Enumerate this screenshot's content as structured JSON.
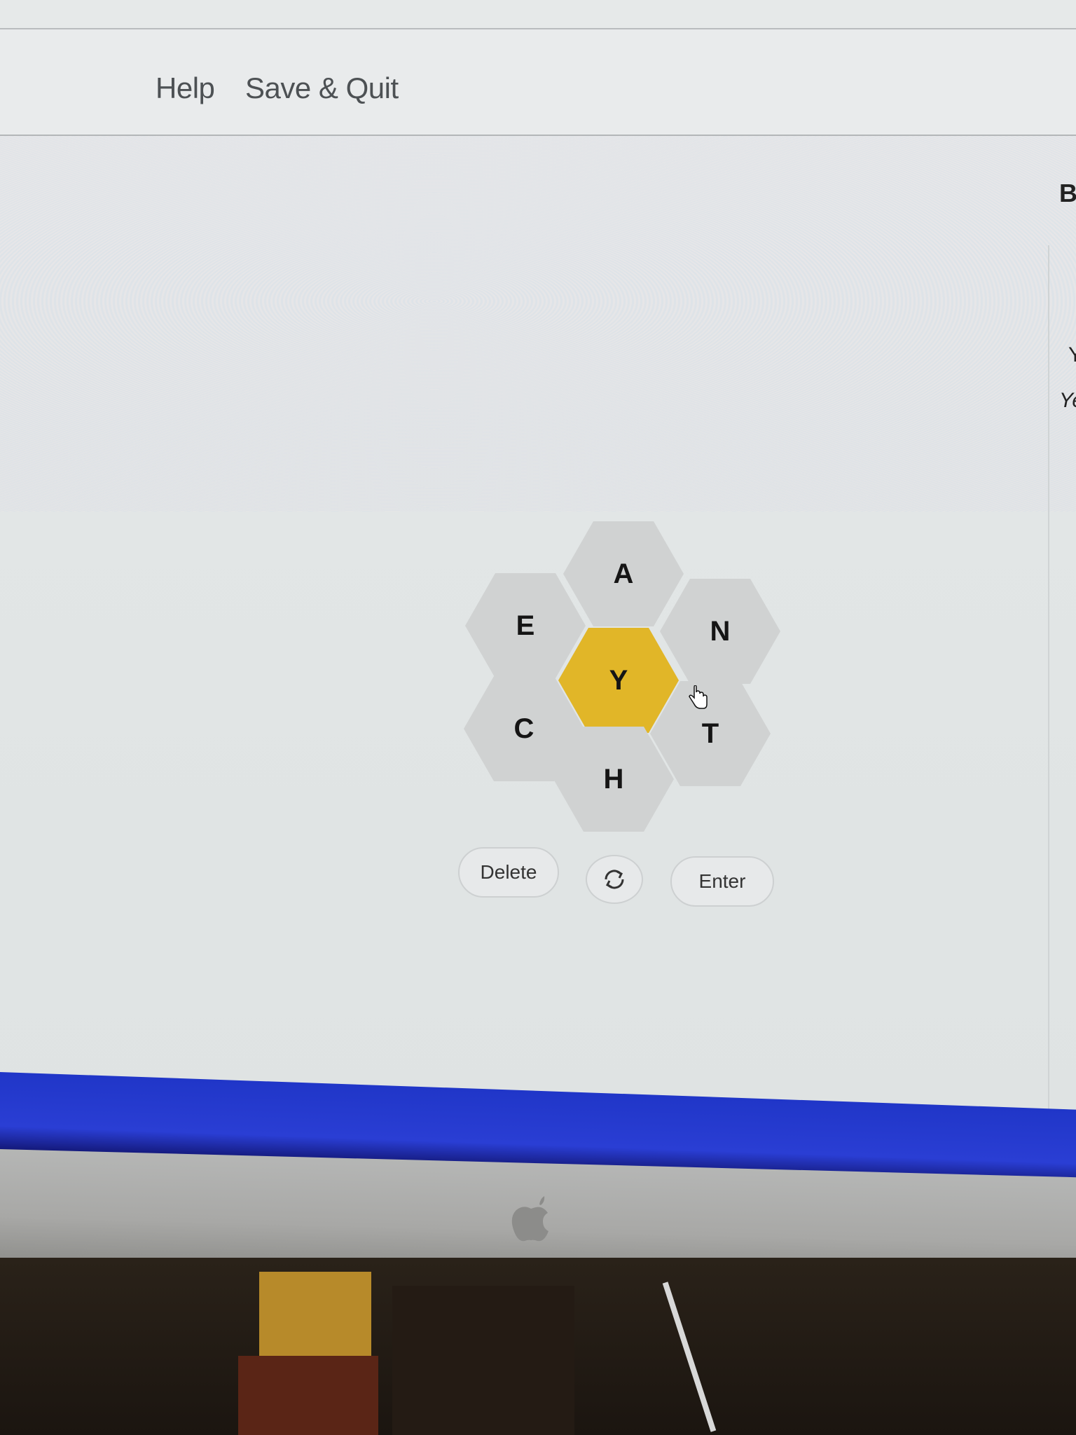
{
  "nav": {
    "help": "Help",
    "save_quit": "Save & Quit"
  },
  "sidebar_partial": {
    "heading": "B",
    "line1": "Y",
    "line2": "Ye"
  },
  "hive": {
    "center": "Y",
    "top": "A",
    "upper_left": "E",
    "upper_right": "N",
    "lower_left": "C",
    "lower_right": "T",
    "bottom": "H"
  },
  "controls": {
    "delete": "Delete",
    "enter": "Enter",
    "shuffle_icon": "shuffle-icon"
  },
  "colors": {
    "center_hex": "#e1b628",
    "outer_hex": "#d0d2d2",
    "background": "#e4e7e7"
  }
}
